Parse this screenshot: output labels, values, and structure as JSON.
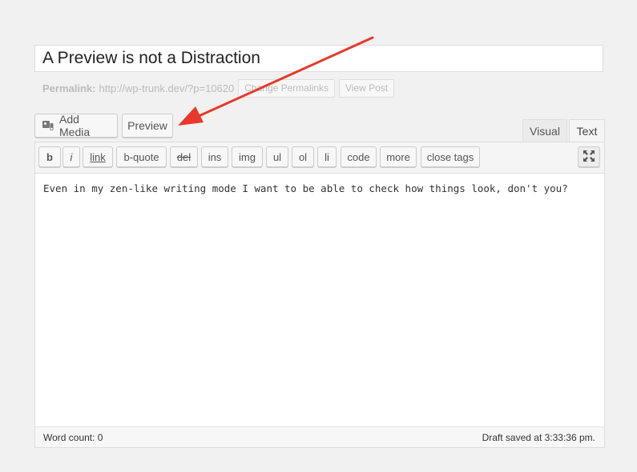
{
  "title": {
    "value": "A Preview is not a Distraction"
  },
  "permalink": {
    "label": "Permalink:",
    "url": "http://wp-trunk.dev/?p=10620",
    "change_button": "Change Permalinks",
    "view_button": "View Post"
  },
  "media_buttons": {
    "add_media": "Add Media",
    "add_media_icon": "media-icon",
    "preview": "Preview"
  },
  "editor_tabs": {
    "visual": "Visual",
    "text": "Text",
    "active": "Text"
  },
  "quicktags": {
    "b": "b",
    "i": "i",
    "link": "link",
    "bquote": "b-quote",
    "del": "del",
    "ins": "ins",
    "img": "img",
    "ul": "ul",
    "ol": "ol",
    "li": "li",
    "code": "code",
    "more": "more",
    "close_tags": "close tags",
    "fullscreen_icon": "fullscreen-icon"
  },
  "content": {
    "text": "Even in my zen-like writing mode I want to be able to check how things look, don't you?"
  },
  "status": {
    "word_count": "Word count: 0",
    "draft_saved": "Draft saved at 3:33:36 pm."
  },
  "annotation": {
    "arrow_color": "#e8392a"
  }
}
